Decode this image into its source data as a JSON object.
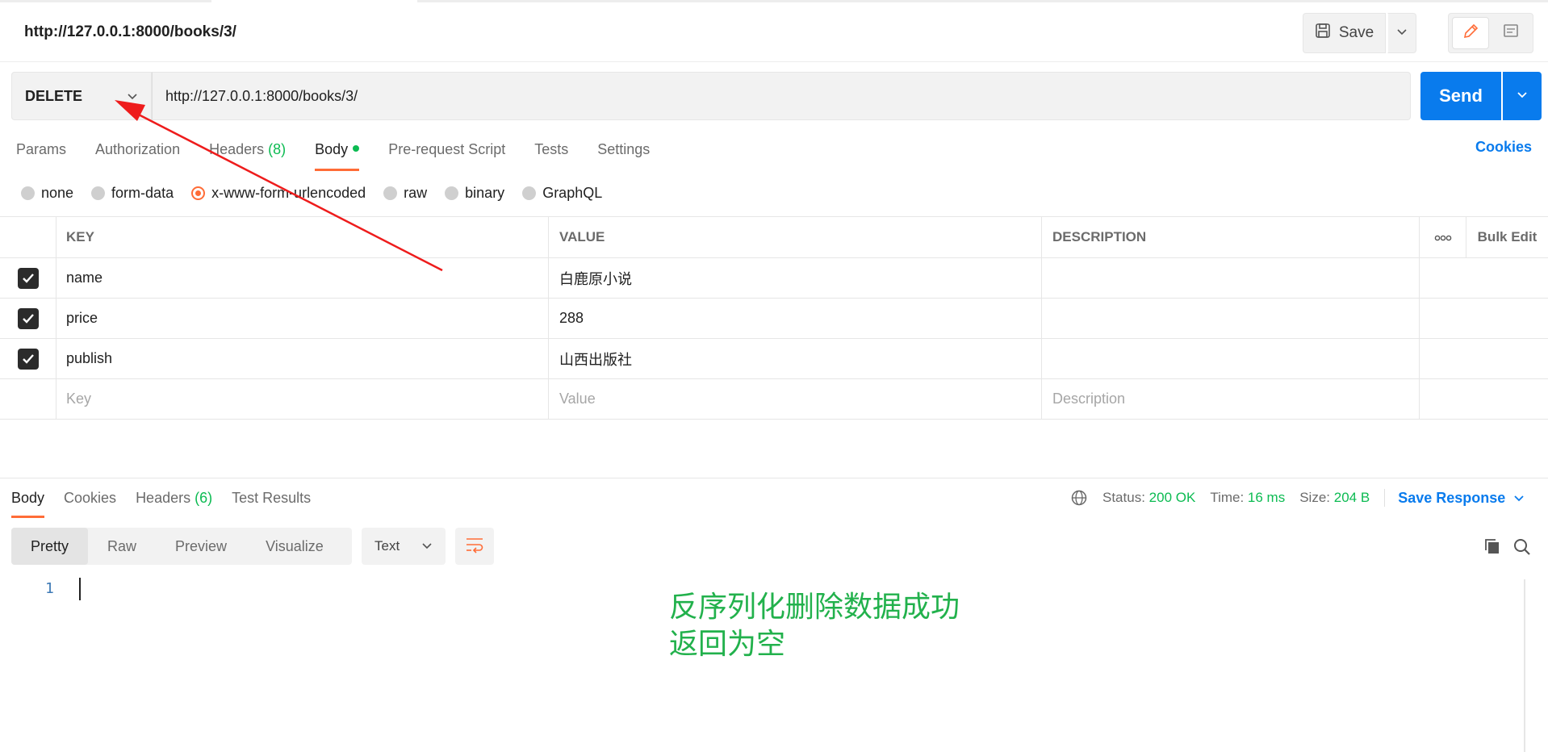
{
  "request": {
    "name": "http://127.0.0.1:8000/books/3/",
    "method": "DELETE",
    "url": "http://127.0.0.1:8000/books/3/"
  },
  "header_actions": {
    "save_label": "Save"
  },
  "send_label": "Send",
  "request_tabs": [
    {
      "label": "Params"
    },
    {
      "label": "Authorization"
    },
    {
      "label": "Headers",
      "count": "(8)"
    },
    {
      "label": "Body"
    },
    {
      "label": "Pre-request Script"
    },
    {
      "label": "Tests"
    },
    {
      "label": "Settings"
    }
  ],
  "cookies_label": "Cookies",
  "body_types": [
    {
      "label": "none"
    },
    {
      "label": "form-data"
    },
    {
      "label": "x-www-form-urlencoded"
    },
    {
      "label": "raw"
    },
    {
      "label": "binary"
    },
    {
      "label": "GraphQL"
    }
  ],
  "kv_table": {
    "headers": {
      "key": "KEY",
      "value": "VALUE",
      "description": "DESCRIPTION",
      "bulk_edit": "Bulk Edit"
    },
    "rows": [
      {
        "key": "name",
        "value": "白鹿原小说"
      },
      {
        "key": "price",
        "value": "288"
      },
      {
        "key": "publish",
        "value": "山西出版社"
      }
    ],
    "placeholders": {
      "key": "Key",
      "value": "Value",
      "description": "Description"
    }
  },
  "response": {
    "tabs": [
      {
        "label": "Body"
      },
      {
        "label": "Cookies"
      },
      {
        "label": "Headers",
        "count": "(6)"
      },
      {
        "label": "Test Results"
      }
    ],
    "status_label": "Status:",
    "status_value": "200 OK",
    "time_label": "Time:",
    "time_value": "16 ms",
    "size_label": "Size:",
    "size_value": "204 B",
    "save_response": "Save Response",
    "view_modes": [
      "Pretty",
      "Raw",
      "Preview",
      "Visualize"
    ],
    "format": "Text",
    "line_number": "1"
  },
  "annotation": {
    "line1": "反序列化删除数据成功",
    "line2": "返回为空"
  },
  "colors": {
    "accent_orange": "#ff6c37",
    "send_blue": "#097bed",
    "status_green": "#0cbb52",
    "annotation_green": "#22b14c",
    "arrow_red": "#ee1c1c"
  }
}
